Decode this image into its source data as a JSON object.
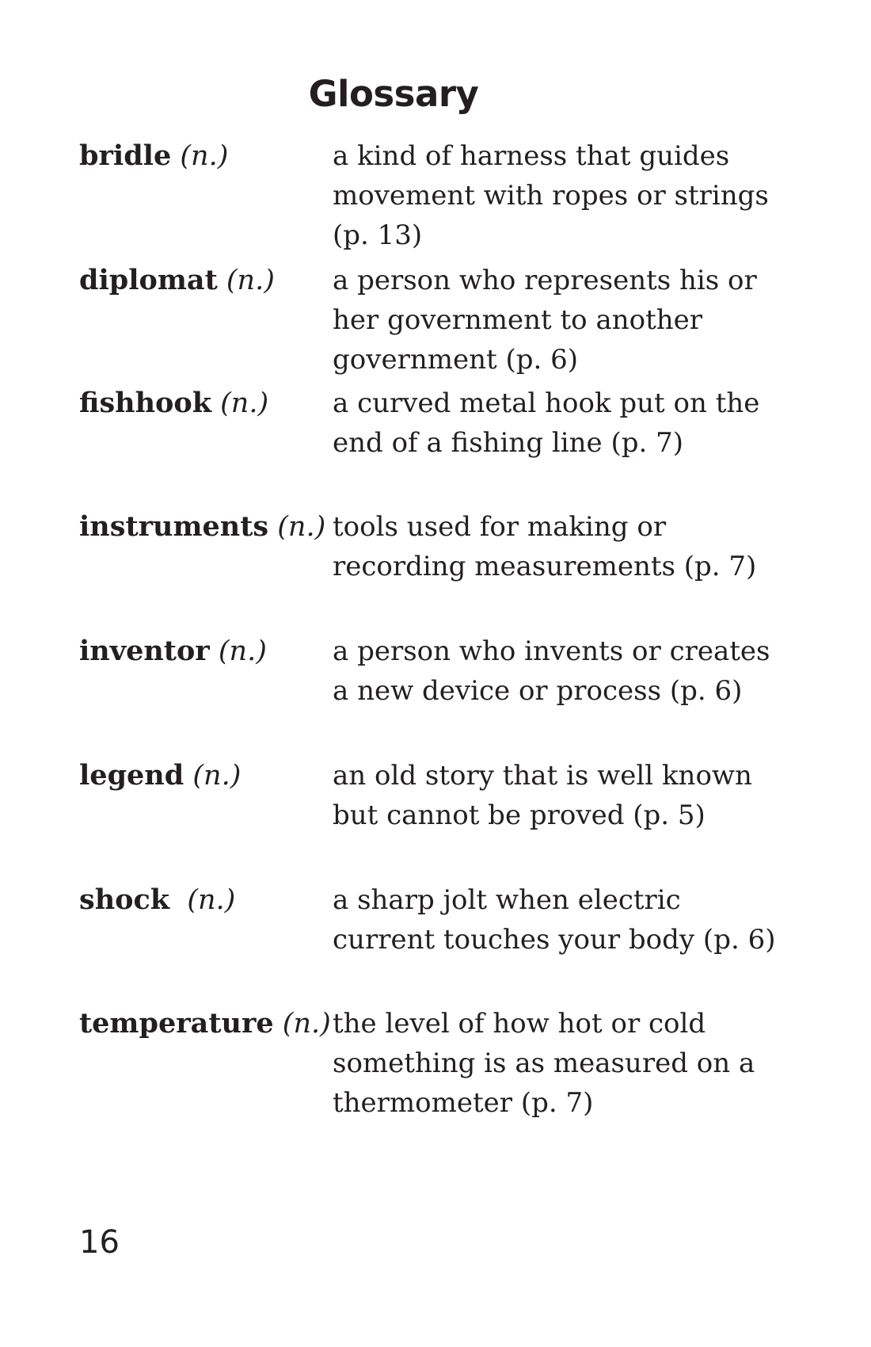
{
  "page": {
    "title": "Glossary",
    "page_number": "16"
  },
  "entries": [
    {
      "term": "bridle",
      "pos": "(n.)",
      "definition": "a kind of harness that guides movement with ropes or strings (p. 13)"
    },
    {
      "term": "diplomat",
      "pos": "(n.)",
      "definition": "a person who represents his or her government to another government (p. 6)"
    },
    {
      "term": "fishhook",
      "pos": "(n.)",
      "definition": "a curved metal hook put on the end of a fishing line (p. 7)"
    },
    {
      "term": "instruments",
      "pos": "(n.)",
      "definition": "tools used for making or recording measurements (p. 7)"
    },
    {
      "term": "inventor",
      "pos": "(n.)",
      "definition": "a person who invents or creates a new device or process (p. 6)"
    },
    {
      "term": "legend",
      "pos": "(n.)",
      "definition": "an old story that is well known but cannot be proved (p. 5)"
    },
    {
      "term": "shock",
      "pos": "(n.)",
      "definition": "a sharp jolt when electric current touches your body (p. 6)"
    },
    {
      "term": "temperature",
      "pos": "(n.)",
      "definition": "the level of how hot or cold something is as measured on a thermometer (p. 7)"
    }
  ]
}
